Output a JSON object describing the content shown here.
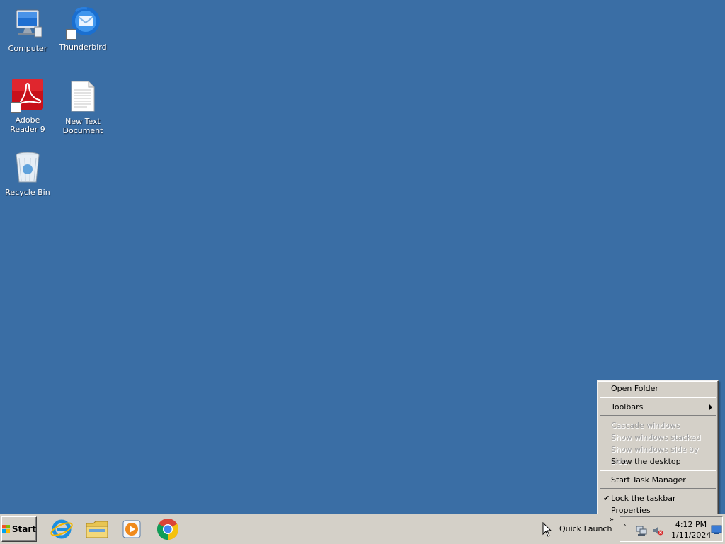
{
  "desktop": {
    "icons": [
      {
        "label": "Computer",
        "icon": "computer-icon"
      },
      {
        "label": "Thunderbird",
        "icon": "thunderbird-icon"
      },
      {
        "label": "Adobe Reader 9",
        "icon": "adobe-reader-icon"
      },
      {
        "label": "New Text Document",
        "icon": "text-document-icon"
      },
      {
        "label": "Recycle Bin",
        "icon": "recycle-bin-icon"
      }
    ]
  },
  "taskbar": {
    "start_label": "Start",
    "quick_launch": [
      {
        "icon": "internet-explorer-icon"
      },
      {
        "icon": "windows-explorer-icon"
      },
      {
        "icon": "media-player-icon"
      },
      {
        "icon": "chrome-icon"
      }
    ],
    "quick_launch_label": "Quick Launch",
    "tray": {
      "time": "4:12 PM",
      "date": "1/11/2024"
    }
  },
  "context_menu": {
    "items": [
      {
        "label": "Open Folder",
        "enabled": true
      },
      {
        "label": "Toolbars",
        "enabled": true,
        "submenu": true
      },
      {
        "label": "Cascade windows",
        "enabled": false
      },
      {
        "label": "Show windows stacked",
        "enabled": false
      },
      {
        "label": "Show windows side by side",
        "enabled": false
      },
      {
        "label": "Show the desktop",
        "enabled": true
      },
      {
        "label": "Start Task Manager",
        "enabled": true
      },
      {
        "label": "Lock the taskbar",
        "enabled": true,
        "checked": true
      },
      {
        "label": "Properties",
        "enabled": true
      }
    ]
  },
  "colors": {
    "desktop_background": "#3a6ea5",
    "taskbar": "#d4d0c8"
  }
}
